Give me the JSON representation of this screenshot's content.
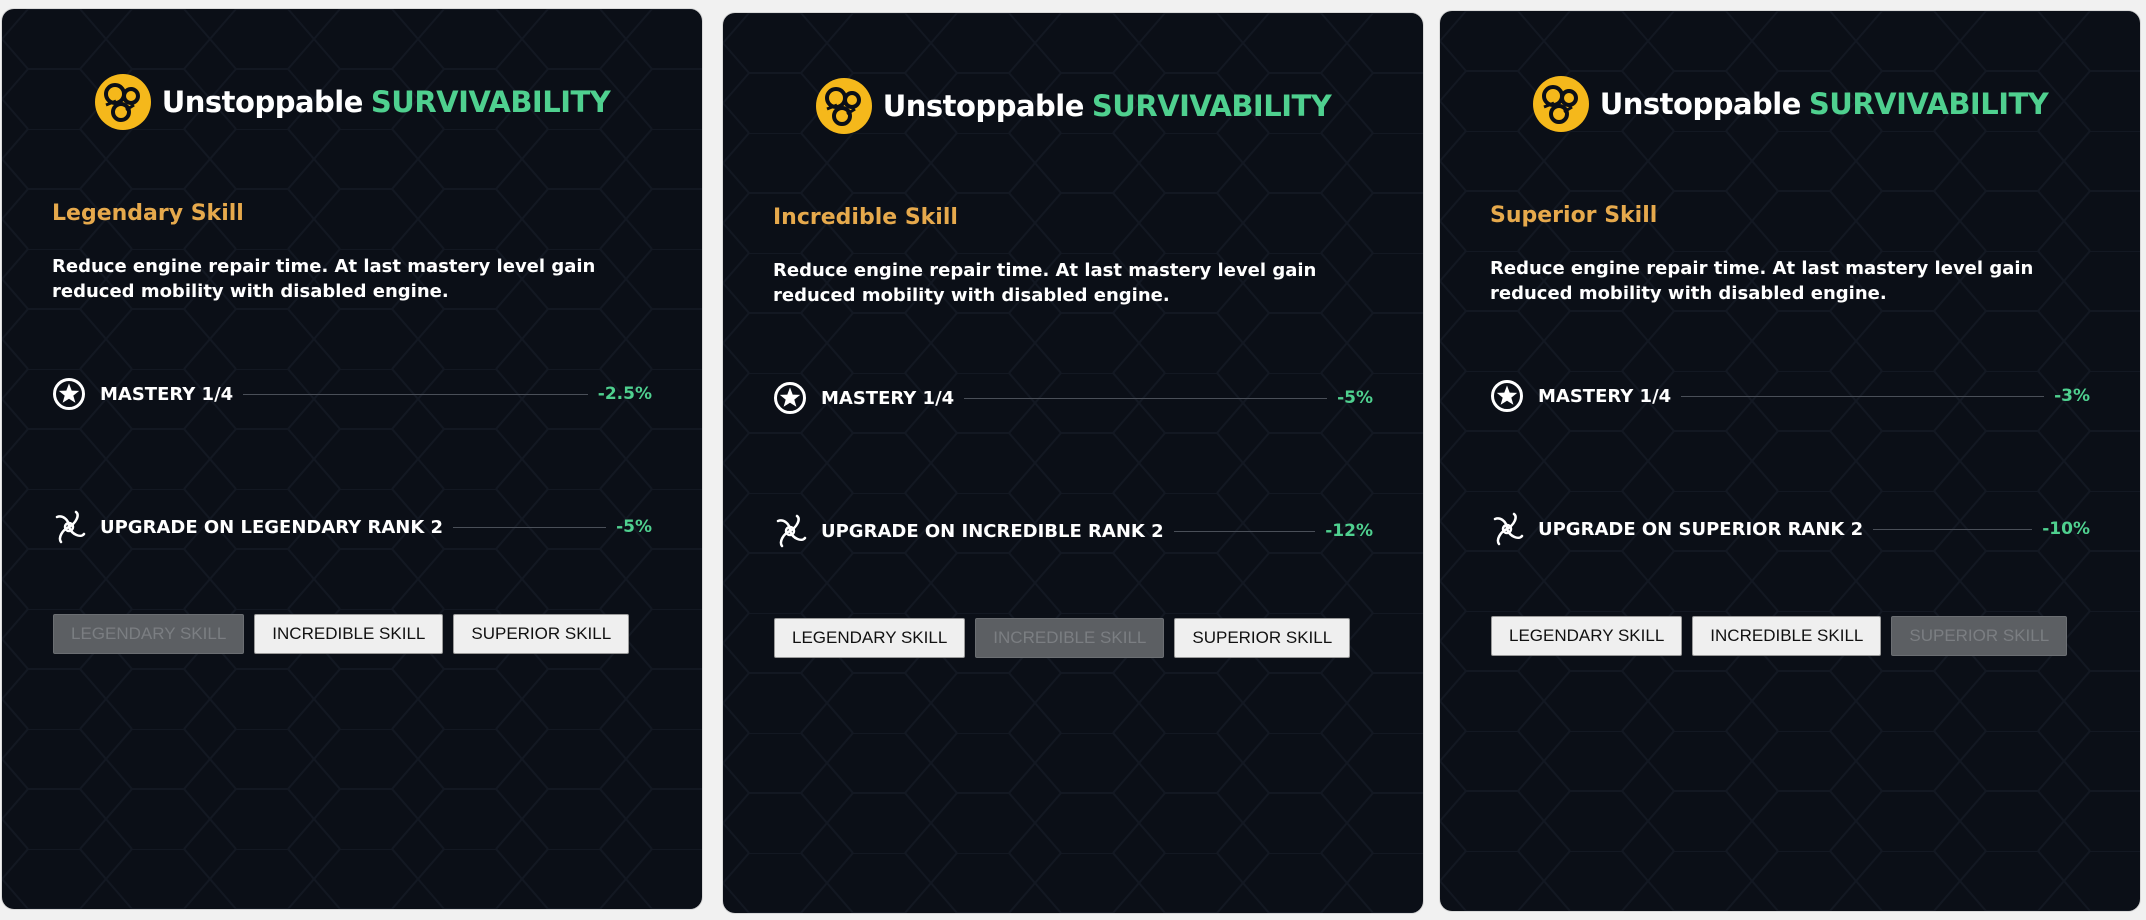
{
  "colors": {
    "background": "#0b0f17",
    "accent": "#4fd08f",
    "skill": "#e6a94c",
    "logo": "#f5b81b"
  },
  "header": {
    "title_main": "Unstoppable",
    "title_accent": "SURVIVABILITY",
    "logo_icon": "survivability-emblem-icon"
  },
  "panels": [
    {
      "skill_name": "Legendary Skill",
      "description": "Reduce engine repair time. At last mastery level gain reduced mobility with disabled engine.",
      "mastery": {
        "icon": "star-circle-icon",
        "label": "MASTERY 1/4",
        "value": "-2.5%"
      },
      "upgrade": {
        "icon": "triskelion-icon",
        "label": "UPGRADE ON LEGENDARY RANK 2",
        "value": "-5%"
      },
      "buttons": [
        {
          "label": "LEGENDARY SKILL",
          "disabled": true
        },
        {
          "label": "INCREDIBLE SKILL",
          "disabled": false
        },
        {
          "label": "SUPERIOR SKILL",
          "disabled": false
        }
      ]
    },
    {
      "skill_name": "Incredible Skill",
      "description": "Reduce engine repair time. At last mastery level gain reduced mobility with disabled engine.",
      "mastery": {
        "icon": "star-circle-icon",
        "label": "MASTERY 1/4",
        "value": "-5%"
      },
      "upgrade": {
        "icon": "triskelion-icon",
        "label": "UPGRADE ON INCREDIBLE RANK 2",
        "value": "-12%"
      },
      "buttons": [
        {
          "label": "LEGENDARY SKILL",
          "disabled": false
        },
        {
          "label": "INCREDIBLE SKILL",
          "disabled": true
        },
        {
          "label": "SUPERIOR SKILL",
          "disabled": false
        }
      ]
    },
    {
      "skill_name": "Superior Skill",
      "description": "Reduce engine repair time. At last mastery level gain reduced mobility with disabled engine.",
      "mastery": {
        "icon": "star-circle-icon",
        "label": "MASTERY 1/4",
        "value": "-3%"
      },
      "upgrade": {
        "icon": "triskelion-icon",
        "label": "UPGRADE ON SUPERIOR RANK 2",
        "value": "-10%"
      },
      "buttons": [
        {
          "label": "LEGENDARY SKILL",
          "disabled": false
        },
        {
          "label": "INCREDIBLE SKILL",
          "disabled": false
        },
        {
          "label": "SUPERIOR SKILL",
          "disabled": true
        }
      ]
    }
  ]
}
